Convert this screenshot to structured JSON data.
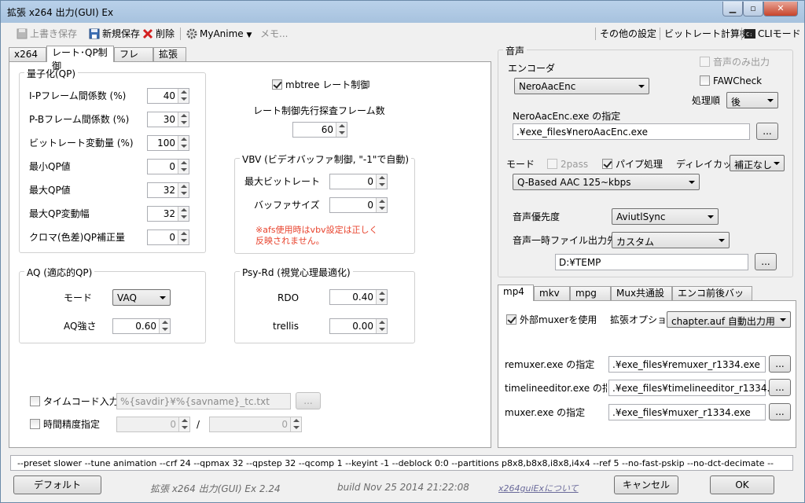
{
  "window": {
    "title": "拡張 x264 出力(GUI) Ex"
  },
  "toolbar": {
    "overwrite_save": "上書き保存",
    "new_save": "新規保存",
    "delete": "削除",
    "profile": "MyAnime",
    "memo": "メモ...",
    "other_settings": "その他の設定",
    "bitrate_calc": "ビットレート計算機",
    "cli_mode": "CLIモード"
  },
  "left_tabs": [
    "x264",
    "レート･QP制御",
    "フレーム",
    "拡張"
  ],
  "quant": {
    "title": "量子化(QP)",
    "rows": [
      {
        "label": "I-Pフレーム間係数 (%)",
        "value": "40"
      },
      {
        "label": "P-Bフレーム間係数 (%)",
        "value": "30"
      },
      {
        "label": "ビットレート変動量 (%)",
        "value": "100"
      },
      {
        "label": "最小QP値",
        "value": "0"
      },
      {
        "label": "最大QP値",
        "value": "32"
      },
      {
        "label": "最大QP変動幅",
        "value": "32"
      },
      {
        "label": "クロマ(色差)QP補正量",
        "value": "0"
      }
    ]
  },
  "mbtree": {
    "label": "mbtree レート制御",
    "checked": true
  },
  "lookahead": {
    "label": "レート制御先行探査フレーム数",
    "value": "60"
  },
  "vbv": {
    "title": "VBV (ビデオバッファ制御, \"-1\"で自動)",
    "max_bitrate_label": "最大ビットレート",
    "max_bitrate": "0",
    "buffer_label": "バッファサイズ",
    "buffer": "0",
    "note1": "※afs使用時はvbv設定は正しく",
    "note2": "反映されません。"
  },
  "aq": {
    "title": "AQ (適応的QP)",
    "mode_label": "モード",
    "mode": "VAQ",
    "strength_label": "AQ強さ",
    "strength": "0.60"
  },
  "psy": {
    "title": "Psy-Rd (視覚心理最適化)",
    "rdo_label": "RDO",
    "rdo": "0.40",
    "trellis_label": "trellis",
    "trellis": "0.00"
  },
  "timecode": {
    "label": "タイムコード入力",
    "value": "%{savdir}¥%{savname}_tc.txt",
    "browse": "..."
  },
  "timebase": {
    "label": "時間精度指定",
    "num": "0",
    "sep": "/",
    "den": "0"
  },
  "audio": {
    "title": "音声",
    "encoder_label": "エンコーダ",
    "encoder": "NeroAacEnc",
    "audio_only": "音声のみ出力",
    "faw": "FAWCheck",
    "order_label": "処理順",
    "order": "後",
    "exe_label": "NeroAacEnc.exe の指定",
    "exe_path": ".¥exe_files¥neroAacEnc.exe",
    "browse": "...",
    "mode_label": "モード",
    "twopass": "2pass",
    "pipe": "パイプ処理",
    "delay_label": "ディレイカット",
    "delay": "補正なし",
    "mode": "Q-Based AAC 125~kbps",
    "priority_label": "音声優先度",
    "priority": "AviutlSync",
    "temp_label": "音声一時ファイル出力先",
    "temp_mode": "カスタム",
    "temp_path": "D:¥TEMP"
  },
  "mux_tabs": [
    "mp4",
    "mkv",
    "mpg",
    "Mux共通設定",
    "エンコ前後バッチ処理"
  ],
  "mux": {
    "external_muxer": "外部muxerを使用",
    "ext_option_label": "拡張オプション",
    "ext_option": "chapter.auf 自動出力用",
    "rows": [
      {
        "label": "remuxer.exe の指定",
        "path": ".¥exe_files¥remuxer_r1334.exe"
      },
      {
        "label": "timelineeditor.exe の指定",
        "path": ".¥exe_files¥timelineeditor_r1334.exe"
      },
      {
        "label": "muxer.exe の指定",
        "path": ".¥exe_files¥muxer_r1334.exe"
      }
    ],
    "browse": "..."
  },
  "cmdline": "--preset slower --tune animation --crf 24 --qpmax 32 --qpstep 32 --qcomp 1 --keyint -1 --deblock 0:0 --partitions p8x8,b8x8,i8x8,i4x4 --ref 5 --no-fast-pskip --no-dct-decimate --",
  "footer": {
    "default": "デフォルト",
    "app_name": "拡張 x264 出力(GUI) Ex 2.24",
    "build": "build Nov 25 2014 21:22:08",
    "about": "x264guiExについて",
    "cancel": "キャンセル",
    "ok": "OK"
  }
}
